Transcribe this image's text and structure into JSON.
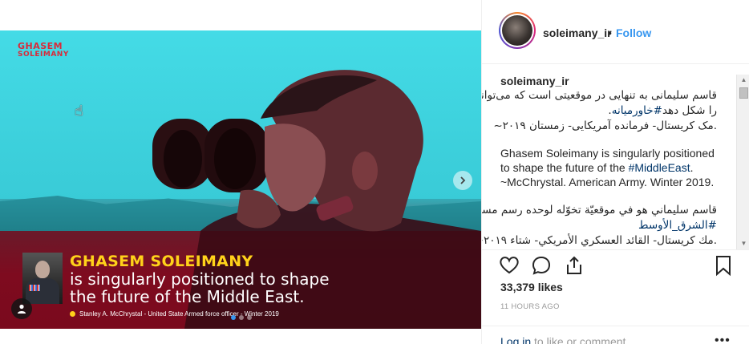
{
  "media": {
    "brand_logo_line1": "GHASEM",
    "brand_logo_line2": "SOLEIMANY",
    "headline": "GHASEM SOLEIMANY",
    "subline_1": "is singularly positioned to shape",
    "subline_2": "the future of the Middle East.",
    "attribution": "Stanley A. McChrystal - United State Armed force officer - Winter 2019",
    "carousel_dots": 3,
    "carousel_active": 1
  },
  "header": {
    "username": "soleimany_ir",
    "separator": "•",
    "follow_label": "Follow"
  },
  "caption": {
    "username": "soleimany_ir",
    "fa_line1": "قاسم سلیمانی به تنهایی در موقعیتی است که می‌تواند آینده",
    "fa_line2_pre": ".",
    "fa_line2_tag": "#خاورمیانه",
    "fa_line2_post": " را شکل دهد",
    "fa_line3": ".مک کریستال- فرمانده آمریکایی- زمستان ۲۰۱۹~",
    "en_line1": "Ghasem Soleimany is singularly positioned",
    "en_line2_pre": "to shape the future of the ",
    "en_line2_tag": "#MiddleEast",
    "en_line2_post": ".",
    "en_line3": "~McChrystal. American Army. Winter 2019.",
    "ar_line1": "قاسم سليماني هو في موقعيّة تخوّله لوحده رسم مستقبل منطقة",
    "ar_line2_tag": "#الشرق_الأوسط",
    "ar_line3": ".مك كريستال- القائد العسكري الأمريكي- شتاء ۲۰۱۹~"
  },
  "footer": {
    "likes": "33,379 likes",
    "time": "11 HOURS AGO",
    "login_link": "Log in",
    "login_rest": " to like or comment.",
    "more": "•••"
  }
}
